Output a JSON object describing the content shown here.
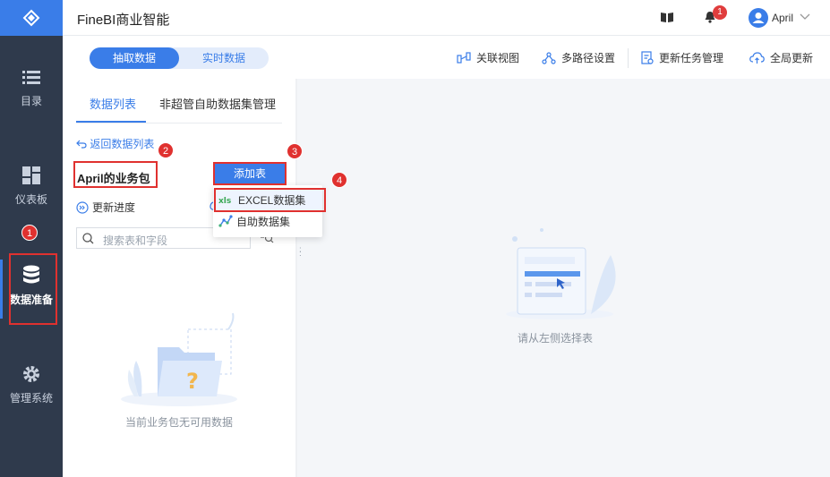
{
  "header": {
    "app_title": "FineBI商业智能",
    "notification_count": "1",
    "user_name": "April"
  },
  "nav": {
    "items": [
      {
        "label": "目录",
        "icon": "list-icon"
      },
      {
        "label": "仪表板",
        "icon": "dashboard-icon"
      },
      {
        "label": "数据准备",
        "icon": "database-icon",
        "active": true
      },
      {
        "label": "管理系统",
        "icon": "gear-icon"
      }
    ]
  },
  "toolbar": {
    "seg_extract": "抽取数据",
    "seg_realtime": "实时数据",
    "relation_view": "关联视图",
    "multipath": "多路径设置",
    "update_tasks": "更新任务管理",
    "global_update": "全局更新"
  },
  "panel": {
    "tab_data_list": "数据列表",
    "tab_self_service": "非超管自助数据集管理",
    "back_link": "返回数据列表",
    "package_title": "April的业务包",
    "update_progress": "更新进度",
    "search_placeholder": "搜索表和字段",
    "empty_text": "当前业务包无可用数据"
  },
  "dropdown": {
    "add_table": "添加表",
    "items": [
      {
        "label": "EXCEL数据集",
        "icon": "excel-icon"
      },
      {
        "label": "自助数据集",
        "icon": "self-service-icon"
      }
    ]
  },
  "right": {
    "empty_text": "请从左侧选择表"
  },
  "annotations": [
    "1",
    "2",
    "3",
    "4"
  ],
  "colors": {
    "accent": "#3a7de8",
    "nav_bg": "#2f3a4c",
    "annotation_red": "#e0312f"
  }
}
